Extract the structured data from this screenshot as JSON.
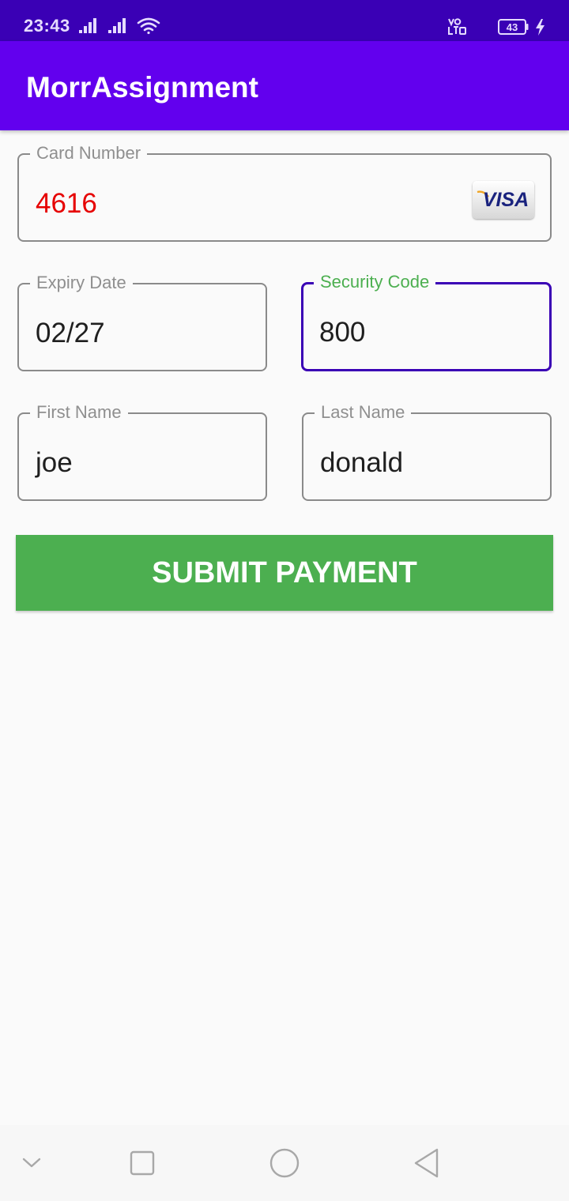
{
  "status_bar": {
    "time": "23:43",
    "battery_level": "43",
    "icons": [
      "signal-icon",
      "signal-icon",
      "wifi-icon",
      "volte-icon",
      "moon-icon",
      "battery-icon",
      "charging-icon"
    ]
  },
  "app_bar": {
    "title": "MorrAssignment"
  },
  "form": {
    "card_number": {
      "label": "Card Number",
      "value": "4616",
      "value_color": "#e60000"
    },
    "card_brand": "VISA",
    "expiry_date": {
      "label": "Expiry Date",
      "value": "02/27"
    },
    "security_code": {
      "label": "Security Code",
      "value": "800"
    },
    "first_name": {
      "label": "First Name",
      "value": "joe"
    },
    "last_name": {
      "label": "Last Name",
      "value": "donald"
    },
    "submit_label": "SUBMIT PAYMENT"
  },
  "nav_bar": {
    "icons": [
      "chevron-down-icon",
      "recents-icon",
      "home-icon",
      "back-icon"
    ]
  },
  "colors": {
    "status_bar": "#3a00b5",
    "app_bar": "#6200ee",
    "focus_border": "#3a00b5",
    "focus_label": "#4caf50",
    "submit_button": "#4caf50"
  }
}
